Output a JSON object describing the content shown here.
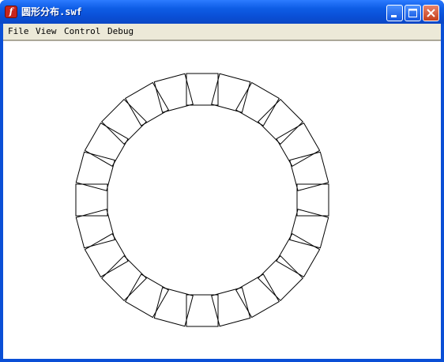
{
  "window": {
    "title": "圆形分布.swf",
    "icon": "flash-player-icon",
    "controls": {
      "minimize": "minimize-icon",
      "maximize": "maximize-icon",
      "close": "close-icon"
    }
  },
  "menu": {
    "items": [
      "File",
      "View",
      "Control",
      "Debug"
    ]
  },
  "stage": {
    "background": "#ffffff",
    "shape_stroke": "#000000",
    "square_count": 24
  }
}
